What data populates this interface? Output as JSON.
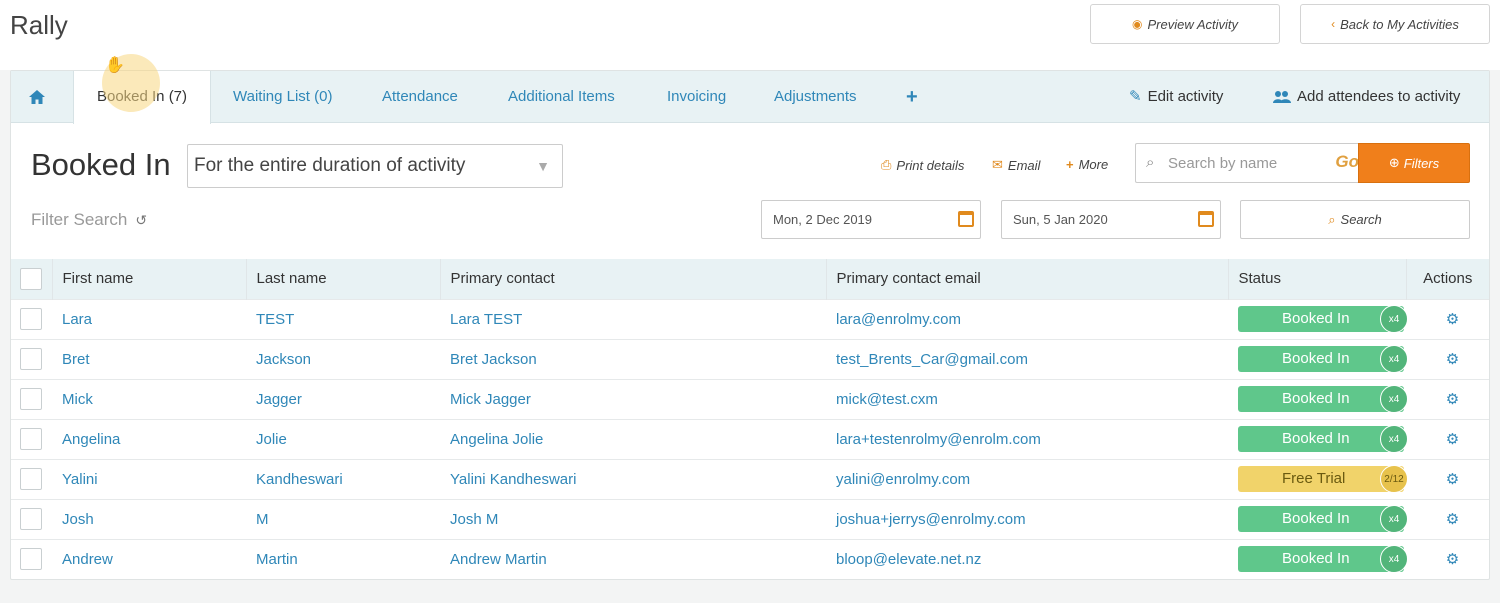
{
  "app": {
    "title": "Rally"
  },
  "top_buttons": {
    "preview_icon": "eye-icon",
    "preview_label": "Preview Activity",
    "back_icon": "chevron-left-icon",
    "back_label": "Back to My Activities"
  },
  "tabs": {
    "home_icon": "home-icon",
    "items": [
      {
        "label": "Booked In (7)",
        "active": true
      },
      {
        "label": "Waiting List (0)"
      },
      {
        "label": "Attendance"
      },
      {
        "label": "Additional Items"
      },
      {
        "label": "Invoicing"
      },
      {
        "label": "Adjustments"
      }
    ],
    "plus_label": "+",
    "edit_label": "Edit activity",
    "add_attendees_label": "Add attendees to activity"
  },
  "section": {
    "title": "Booked In",
    "duration_value": "For the entire duration of activity",
    "actions": {
      "print": "Print details",
      "email": "Email",
      "more": "More"
    },
    "search": {
      "placeholder": "Search by name",
      "go": "Go",
      "filters": "Filters"
    },
    "filter_search": "Filter Search",
    "date_from": "Mon, 2 Dec 2019",
    "date_to": "Sun, 5 Jan 2020",
    "search_button": "Search"
  },
  "table": {
    "columns": [
      "First name",
      "Last name",
      "Primary contact",
      "Primary contact email",
      "Status",
      "Actions"
    ],
    "rows": [
      {
        "first": "Lara",
        "last": "TEST",
        "contact": "Lara TEST",
        "email": "lara@enrolmy.com",
        "status": "Booked In",
        "count": "x4",
        "type": "booked"
      },
      {
        "first": "Bret",
        "last": "Jackson",
        "contact": "Bret Jackson",
        "email": "test_Brents_Car@gmail.com",
        "status": "Booked In",
        "count": "x4",
        "type": "booked"
      },
      {
        "first": "Mick",
        "last": "Jagger",
        "contact": "Mick Jagger",
        "email": "mick@test.cxm",
        "status": "Booked In",
        "count": "x4",
        "type": "booked"
      },
      {
        "first": "Angelina",
        "last": "Jolie",
        "contact": "Angelina Jolie",
        "email": "lara+testenrolmy@enrolm.com",
        "status": "Booked In",
        "count": "x4",
        "type": "booked"
      },
      {
        "first": "Yalini",
        "last": "Kandheswari",
        "contact": "Yalini Kandheswari",
        "email": "yalini@enrolmy.com",
        "status": "Free Trial",
        "count": "2/12",
        "type": "trial"
      },
      {
        "first": "Josh",
        "last": "M",
        "contact": "Josh M",
        "email": "joshua+jerrys@enrolmy.com",
        "status": "Booked In",
        "count": "x4",
        "type": "booked"
      },
      {
        "first": "Andrew",
        "last": "Martin",
        "contact": "Andrew Martin",
        "email": "bloop@elevate.net.nz",
        "status": "Booked In",
        "count": "x4",
        "type": "booked"
      }
    ]
  },
  "colors": {
    "accent_blue": "#2f87b8",
    "accent_orange": "#f07f1b",
    "booked_green": "#5fc78b",
    "trial_yellow": "#f1d36a"
  }
}
